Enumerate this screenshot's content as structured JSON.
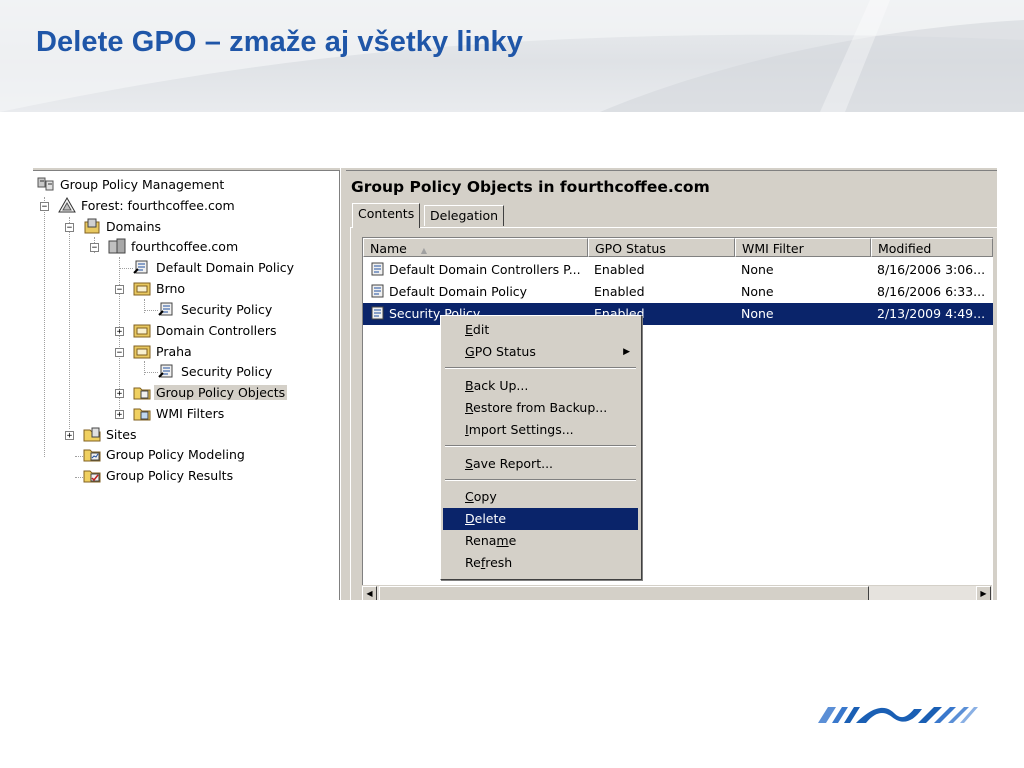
{
  "slide": {
    "title": "Delete GPO – zmaže aj všetky linky"
  },
  "tree": {
    "items": [
      {
        "label": "Group Policy Management",
        "icon": "gpm-icon",
        "toggle": ""
      },
      {
        "label": "Forest: fourthcoffee.com",
        "icon": "forest-icon",
        "toggle": "−"
      },
      {
        "label": "Domains",
        "icon": "domains-icon",
        "toggle": "−"
      },
      {
        "label": "fourthcoffee.com",
        "icon": "domain-icon",
        "toggle": "−"
      },
      {
        "label": "Default Domain Policy",
        "icon": "gpo-link-icon",
        "toggle": ""
      },
      {
        "label": "Brno",
        "icon": "ou-icon",
        "toggle": "−"
      },
      {
        "label": "Security Policy",
        "icon": "gpo-link-icon",
        "toggle": ""
      },
      {
        "label": "Domain Controllers",
        "icon": "ou-icon",
        "toggle": "+"
      },
      {
        "label": "Praha",
        "icon": "ou-icon",
        "toggle": "−"
      },
      {
        "label": "Security Policy",
        "icon": "gpo-link-icon",
        "toggle": ""
      },
      {
        "label": "Group Policy Objects",
        "icon": "folder-gpo-icon",
        "toggle": "+"
      },
      {
        "label": "WMI Filters",
        "icon": "folder-wmi-icon",
        "toggle": "+"
      },
      {
        "label": "Sites",
        "icon": "sites-icon",
        "toggle": "+"
      },
      {
        "label": "Group Policy Modeling",
        "icon": "modeling-icon",
        "toggle": ""
      },
      {
        "label": "Group Policy Results",
        "icon": "results-icon",
        "toggle": ""
      }
    ]
  },
  "pane": {
    "title": "Group Policy Objects in fourthcoffee.com",
    "tabs": [
      "Contents",
      "Delegation"
    ],
    "columns": [
      "Name",
      "GPO Status",
      "WMI Filter",
      "Modified"
    ],
    "rows": [
      [
        "Default Domain Controllers P...",
        "Enabled",
        "None",
        "8/16/2006 3:06..."
      ],
      [
        "Default Domain Policy",
        "Enabled",
        "None",
        "8/16/2006 6:33..."
      ],
      [
        "Security Policy",
        "Enabled",
        "None",
        "2/13/2009 4:49..."
      ]
    ]
  },
  "menu": {
    "items": [
      {
        "label": "Edit",
        "mnemonic": "E"
      },
      {
        "label": "GPO Status",
        "mnemonic": "G",
        "submenu": true
      },
      {
        "label": "Back Up...",
        "mnemonic": "B"
      },
      {
        "label": "Restore from Backup...",
        "mnemonic": "R"
      },
      {
        "label": "Import Settings...",
        "mnemonic": "I"
      },
      {
        "label": "Save Report...",
        "mnemonic": "S"
      },
      {
        "label": "Copy",
        "mnemonic": "C"
      },
      {
        "label": "Delete",
        "mnemonic": "D"
      },
      {
        "label": "Rename",
        "mnemonic": "m"
      },
      {
        "label": "Refresh",
        "mnemonic": "f"
      }
    ]
  },
  "colors": {
    "title": "#1f56a8",
    "selection": "#0a246a",
    "logo": "#1a5fb4"
  }
}
